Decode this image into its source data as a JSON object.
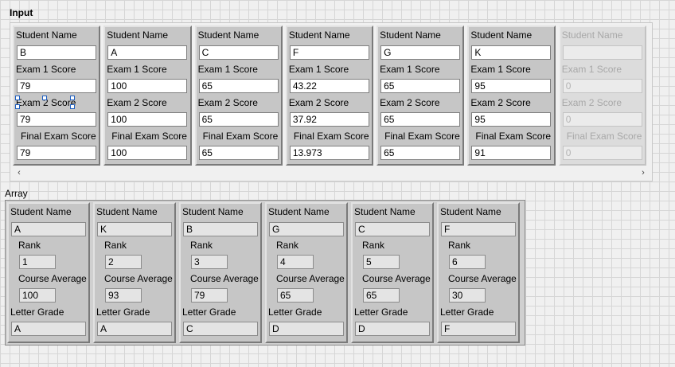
{
  "input": {
    "title": "Input",
    "labels": {
      "student_name": "Student Name",
      "exam1": "Exam 1 Score",
      "exam2": "Exam 2 Score",
      "final": "Final Exam Score"
    },
    "clusters": [
      {
        "name": "B",
        "exam1": "79",
        "exam2": "79",
        "final": "79"
      },
      {
        "name": "A",
        "exam1": "100",
        "exam2": "100",
        "final": "100"
      },
      {
        "name": "C",
        "exam1": "65",
        "exam2": "65",
        "final": "65"
      },
      {
        "name": "F",
        "exam1": "43.22",
        "exam2": "37.92",
        "final": "13.973"
      },
      {
        "name": "G",
        "exam1": "65",
        "exam2": "65",
        "final": "65"
      },
      {
        "name": "K",
        "exam1": "95",
        "exam2": "95",
        "final": "91"
      },
      {
        "name": "",
        "exam1": "0",
        "exam2": "0",
        "final": "0"
      }
    ],
    "scroll_left": "‹",
    "scroll_right": "›"
  },
  "output": {
    "title": "Array",
    "labels": {
      "student_name": "Student Name",
      "rank": "Rank",
      "course_average": "Course Average",
      "letter_grade": "Letter Grade"
    },
    "clusters": [
      {
        "name": "A",
        "rank": "1",
        "average": "100",
        "grade": "A"
      },
      {
        "name": "K",
        "rank": "2",
        "average": "93",
        "grade": "A"
      },
      {
        "name": "B",
        "rank": "3",
        "average": "79",
        "grade": "C"
      },
      {
        "name": "G",
        "rank": "4",
        "average": "65",
        "grade": "D"
      },
      {
        "name": "C",
        "rank": "5",
        "average": "65",
        "grade": "D"
      },
      {
        "name": "F",
        "rank": "6",
        "average": "30",
        "grade": "F"
      }
    ]
  },
  "colors": {
    "cluster_bg": "#c6c6c6",
    "selection_handle": "#1f5fbf"
  }
}
